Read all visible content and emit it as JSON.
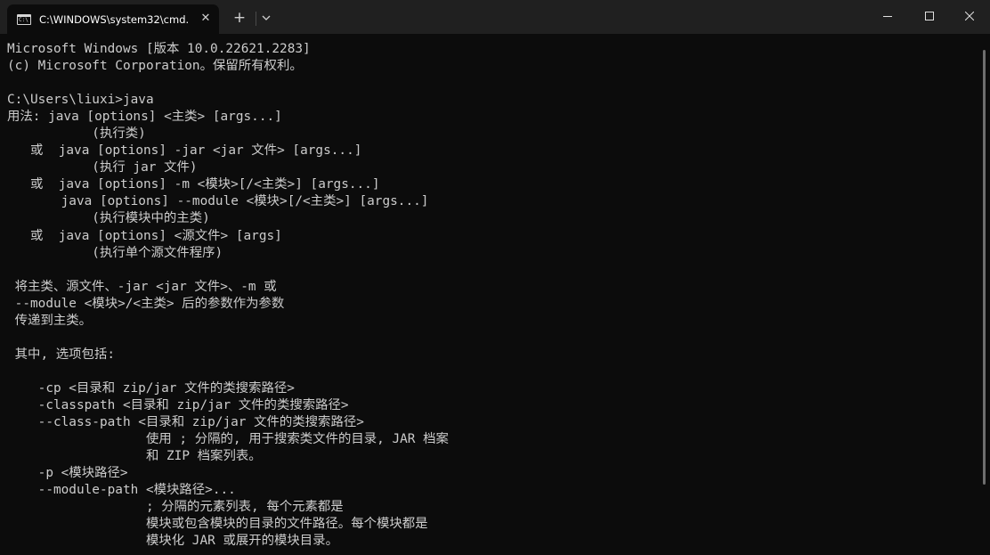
{
  "tab": {
    "title": "C:\\WINDOWS\\system32\\cmd.",
    "icon_label": "C:\\",
    "close_glyph": "✕"
  },
  "toolbar": {
    "new_tab_glyph": "+"
  },
  "icons": {
    "tab": "terminal-icon",
    "close_tab": "close-icon",
    "new_tab": "plus-icon",
    "dropdown": "chevron-down-icon",
    "minimize": "minimize-icon",
    "maximize": "maximize-icon",
    "close_window": "close-icon"
  },
  "colors": {
    "console_bg": "#0c0c0c",
    "console_text": "#cccccc",
    "titlebar_bg": "#202020"
  },
  "console": {
    "lines": [
      "Microsoft Windows [版本 10.0.22621.2283]",
      "(c) Microsoft Corporation。保留所有权利。",
      "",
      "C:\\Users\\liuxi>java",
      "用法: java [options] <主类> [args...]",
      "           (执行类)",
      "   或  java [options] -jar <jar 文件> [args...]",
      "           (执行 jar 文件)",
      "   或  java [options] -m <模块>[/<主类>] [args...]",
      "       java [options] --module <模块>[/<主类>] [args...]",
      "           (执行模块中的主类)",
      "   或  java [options] <源文件> [args]",
      "           (执行单个源文件程序)",
      "",
      " 将主类、源文件、-jar <jar 文件>、-m 或",
      " --module <模块>/<主类> 后的参数作为参数",
      " 传递到主类。",
      "",
      " 其中, 选项包括:",
      "",
      "    -cp <目录和 zip/jar 文件的类搜索路径>",
      "    -classpath <目录和 zip/jar 文件的类搜索路径>",
      "    --class-path <目录和 zip/jar 文件的类搜索路径>",
      "                  使用 ; 分隔的, 用于搜索类文件的目录, JAR 档案",
      "                  和 ZIP 档案列表。",
      "    -p <模块路径>",
      "    --module-path <模块路径>...",
      "                  ; 分隔的元素列表, 每个元素都是",
      "                  模块或包含模块的目录的文件路径。每个模块都是",
      "                  模块化 JAR 或展开的模块目录。"
    ]
  }
}
